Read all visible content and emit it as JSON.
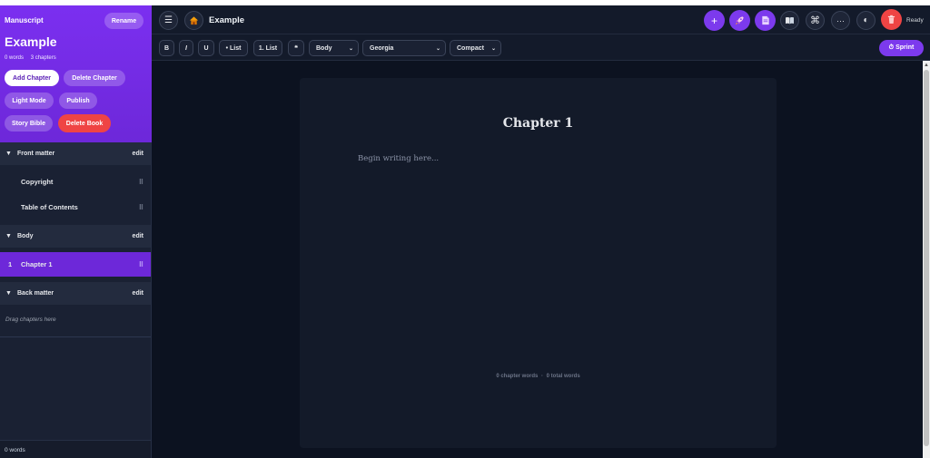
{
  "sidebar": {
    "heading": "Manuscript",
    "rename_label": "Rename",
    "book_title": "Example",
    "stats": {
      "words": "0 words",
      "chapters": "3 chapters"
    },
    "buttons": {
      "add_chapter": "Add Chapter",
      "delete_chapter": "Delete Chapter",
      "light_mode": "Light Mode",
      "publish": "Publish",
      "story_bible": "Story Bible",
      "delete_book": "Delete Book"
    },
    "sections": [
      {
        "label": "Front matter",
        "edit": "edit",
        "items": [
          "Copyright",
          "Table of Contents"
        ]
      },
      {
        "label": "Body",
        "edit": "edit",
        "items": [
          {
            "number": "1",
            "label": "Chapter 1"
          }
        ]
      },
      {
        "label": "Back matter",
        "edit": "edit",
        "placeholder": "Drag chapters here"
      }
    ],
    "footer_words": "0 words"
  },
  "topbar": {
    "book_title": "Example",
    "status": "Ready",
    "icons": [
      "menu-icon",
      "home-icon",
      "plus-icon",
      "rocket-icon",
      "document-icon",
      "book-icon",
      "command-icon",
      "more-icon",
      "theme-icon",
      "trash-icon"
    ],
    "icon_glyphs": {
      "menu": "☰",
      "plus": "+",
      "command": "⌘",
      "more": "···",
      "theme": "◐"
    }
  },
  "toolbar": {
    "bold": "B",
    "italic": "I",
    "underline": "U",
    "bullet_list": "• List",
    "numbered_list": "1. List",
    "quote": "❝",
    "style_select": "Body",
    "font_select": "Georgia",
    "density_select": "Compact",
    "sprint_label": "⏱ Sprint"
  },
  "editor": {
    "chapter_title": "Chapter 1",
    "placeholder": "Begin writing here...",
    "chapter_words": "0 chapter words",
    "separator": "·",
    "total_words": "0 total words"
  },
  "colors": {
    "accent": "#7c3aed",
    "danger": "#ef4444",
    "background": "#0c1220",
    "sidebar": "#1a2133"
  }
}
